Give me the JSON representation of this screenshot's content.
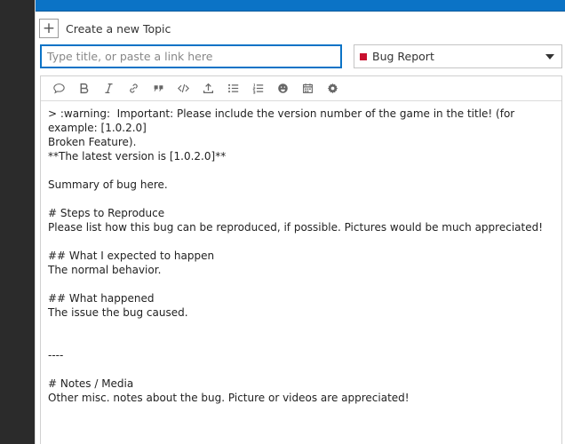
{
  "composer": {
    "header_title": "Create a new Topic",
    "title_placeholder": "Type title, or paste a link here",
    "title_value": "",
    "category": {
      "label": "Bug Report",
      "color": "#c8102e"
    }
  },
  "toolbar": {
    "buttons": [
      "quote-icon",
      "bold-icon",
      "italic-icon",
      "link-icon",
      "blockquote-icon",
      "code-icon",
      "upload-icon",
      "bullet-list-icon",
      "numbered-list-icon",
      "emoji-icon",
      "calendar-icon",
      "gear-icon"
    ]
  },
  "editor": {
    "lines": [
      "> :warning:  Important: Please include the version number of the game in the title! (for example: [1.0.2.0]",
      "Broken Feature).",
      "**The latest version is [1.0.2.0]**",
      "",
      "Summary of bug here.",
      "",
      "# Steps to Reproduce",
      "Please list how this bug can be reproduced, if possible. Pictures would be much appreciated!",
      "",
      "## What I expected to happen",
      "The normal behavior.",
      "",
      "## What happened",
      "The issue the bug caused.",
      "",
      "",
      "----",
      "",
      "# Notes / Media",
      "Other misc. notes about the bug. Picture or videos are appreciated!"
    ]
  }
}
